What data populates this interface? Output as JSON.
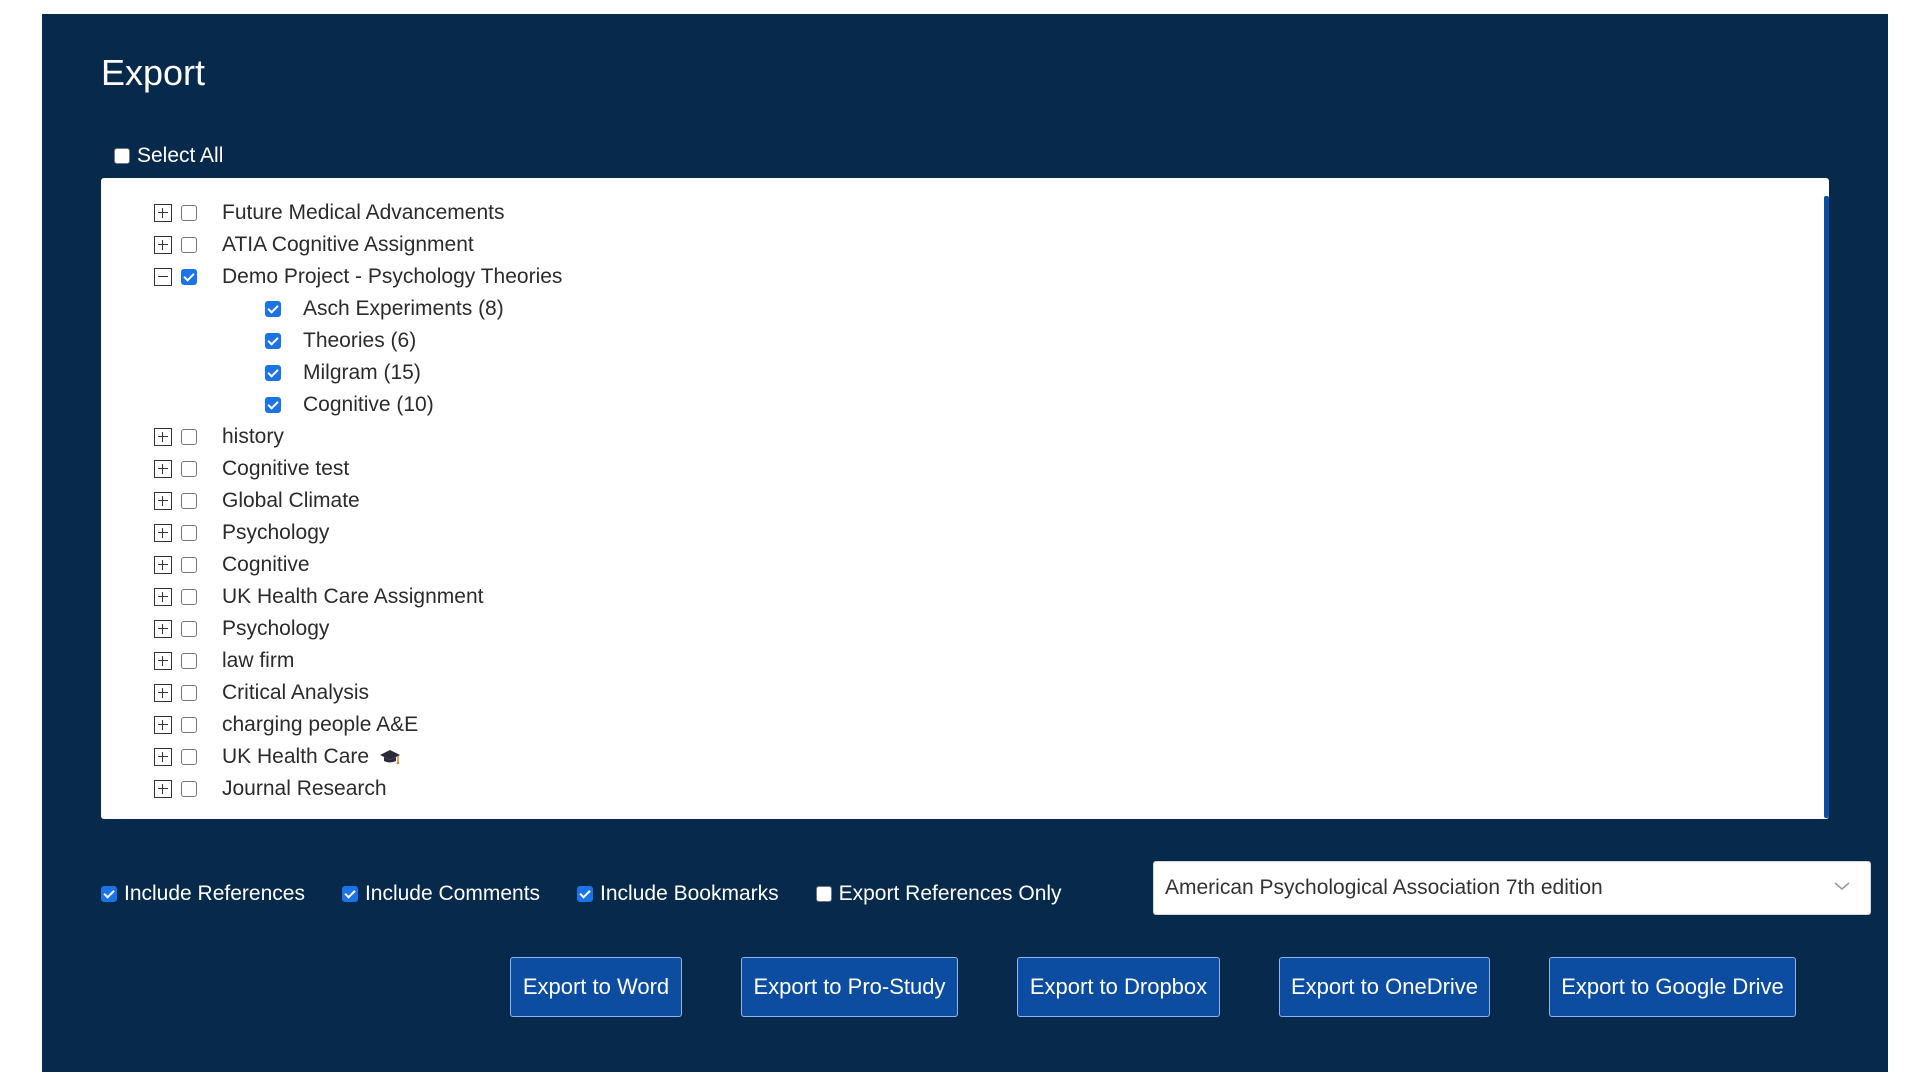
{
  "title": "Export",
  "select_all": {
    "label": "Select All",
    "checked": false
  },
  "tree": [
    {
      "label": "Future Medical Advancements",
      "expanded": false,
      "checked": false
    },
    {
      "label": "ATIA Cognitive Assignment",
      "expanded": false,
      "checked": false
    },
    {
      "label": "Demo Project - Psychology Theories",
      "expanded": true,
      "checked": true,
      "children": [
        {
          "label": "Asch Experiments (8)",
          "checked": true
        },
        {
          "label": "Theories (6)",
          "checked": true
        },
        {
          "label": "Milgram (15)",
          "checked": true
        },
        {
          "label": "Cognitive (10)",
          "checked": true
        }
      ]
    },
    {
      "label": "history",
      "expanded": false,
      "checked": false
    },
    {
      "label": "Cognitive test",
      "expanded": false,
      "checked": false
    },
    {
      "label": "Global Climate",
      "expanded": false,
      "checked": false
    },
    {
      "label": "Psychology",
      "expanded": false,
      "checked": false
    },
    {
      "label": "Cognitive",
      "expanded": false,
      "checked": false
    },
    {
      "label": "UK Health Care Assignment",
      "expanded": false,
      "checked": false
    },
    {
      "label": "Psychology",
      "expanded": false,
      "checked": false
    },
    {
      "label": "law firm",
      "expanded": false,
      "checked": false
    },
    {
      "label": "Critical Analysis",
      "expanded": false,
      "checked": false
    },
    {
      "label": "charging people A&E",
      "expanded": false,
      "checked": false
    },
    {
      "label": "UK Health Care",
      "expanded": false,
      "checked": false,
      "icon": "graduation-cap-icon"
    },
    {
      "label": "Journal Research",
      "expanded": false,
      "checked": false
    }
  ],
  "options": [
    {
      "label": "Include References",
      "checked": true
    },
    {
      "label": "Include Comments",
      "checked": true
    },
    {
      "label": "Include Bookmarks",
      "checked": true
    },
    {
      "label": "Export References Only",
      "checked": false
    }
  ],
  "citation_style": {
    "selected": "American Psychological Association 7th edition",
    "icon": "chevron-down-icon"
  },
  "buttons": [
    {
      "label": "Export to Word"
    },
    {
      "label": "Export to Pro-Study"
    },
    {
      "label": "Export to Dropbox"
    },
    {
      "label": "Export to OneDrive"
    },
    {
      "label": "Export to Google Drive"
    }
  ],
  "colors": {
    "panel_bg": "#072a4c",
    "button_bg": "#0c4da2",
    "checkbox_checked": "#1a73e8"
  }
}
